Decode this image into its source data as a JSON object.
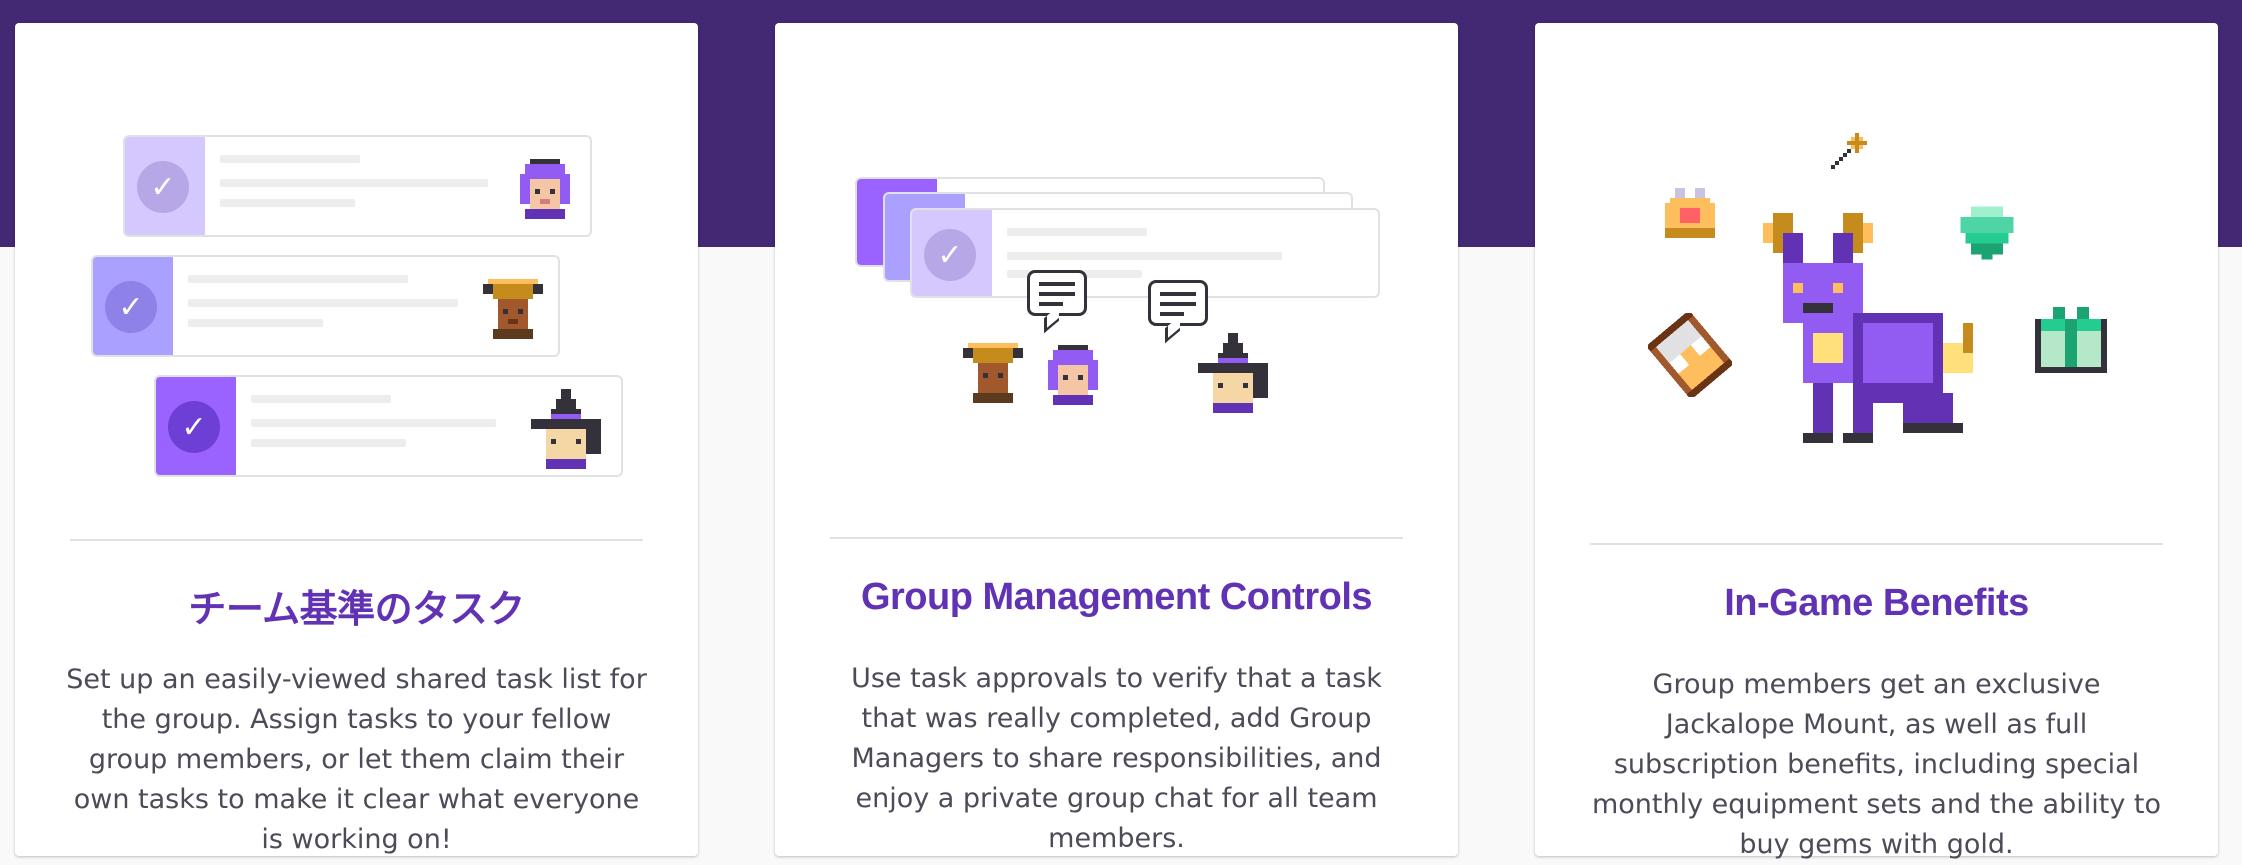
{
  "colors": {
    "band": "#432874",
    "title": "#6133b4",
    "body_text": "#4e4a57",
    "purple_light": "#d5c8ff",
    "purple_mid": "#a9a0ff",
    "purple_dark": "#9a62ff"
  },
  "cards": [
    {
      "title": "チーム基準のタスク",
      "body": "Set up an easily-viewed shared task list for the group. Assign tasks to your fellow group members, or let them claim their own tasks to make it clear what everyone is working on!",
      "illustration": [
        "task-row-icon",
        "checkmark-icon",
        "purple-hair-avatar-icon",
        "gold-helmet-avatar-icon",
        "witch-hat-avatar-icon"
      ]
    },
    {
      "title": "Group Management Controls",
      "body": "Use task approvals to verify that a task that was really completed, add Group Managers to share responsibilities, and enjoy a private group chat for all team members.",
      "illustration": [
        "stacked-task-cards-icon",
        "chat-bubble-icon",
        "avatar-icon"
      ]
    },
    {
      "title": "In-Game Benefits",
      "body": "Group members get an exclusive Jackalope Mount, as well as full subscription benefits, including special monthly equipment sets and the ability to buy gems with gold.",
      "illustration": [
        "jackalope-mount-icon",
        "crown-icon",
        "wand-icon",
        "gem-icon",
        "hourglass-icon",
        "gift-icon"
      ]
    }
  ]
}
